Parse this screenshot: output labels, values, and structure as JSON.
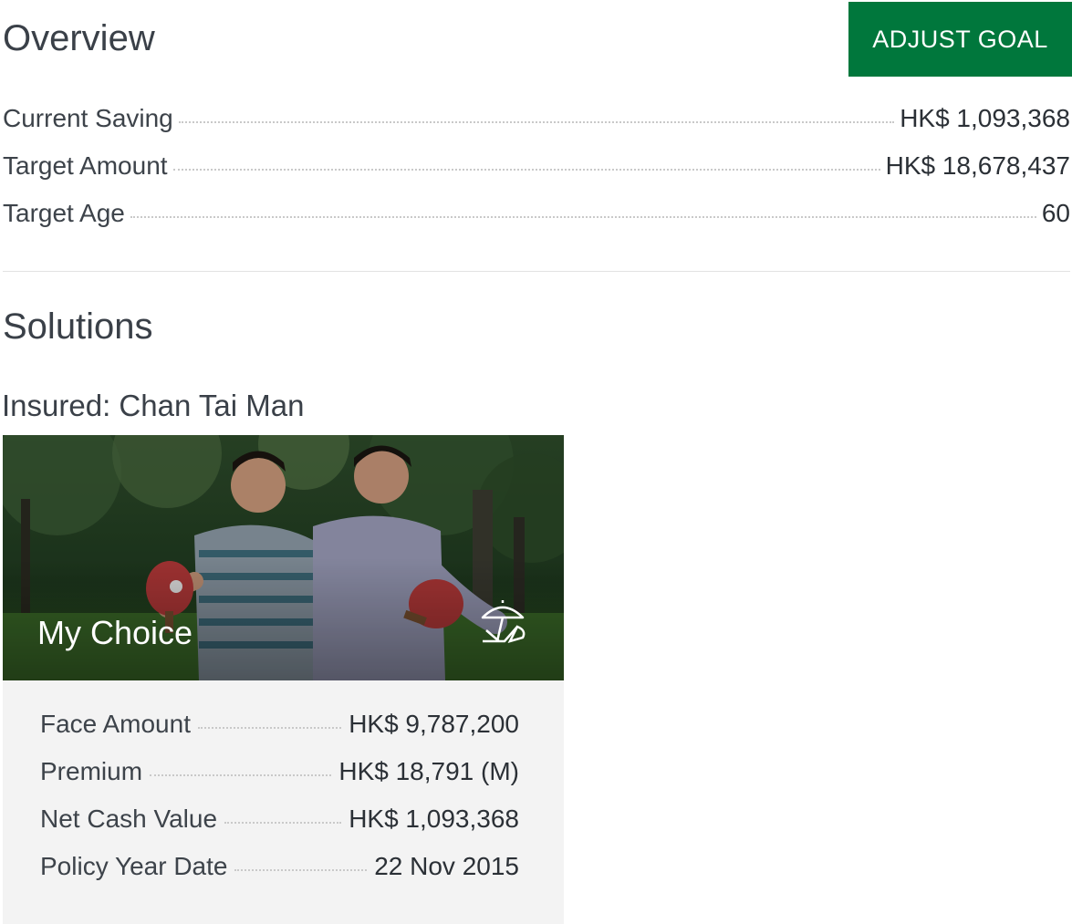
{
  "overview": {
    "title": "Overview",
    "adjust_goal_label": "ADJUST GOAL",
    "rows": [
      {
        "label": "Current Saving",
        "value": "HK$ 1,093,368"
      },
      {
        "label": "Target Amount",
        "value": "HK$ 18,678,437"
      },
      {
        "label": "Target Age",
        "value": "60"
      }
    ]
  },
  "solutions": {
    "title": "Solutions",
    "insured": "Insured: Chan Tai Man",
    "card": {
      "title": "My Choice",
      "icon": "parasol-lounger-icon",
      "rows": [
        {
          "label": "Face Amount",
          "value": "HK$ 9,787,200"
        },
        {
          "label": "Premium",
          "value": "HK$ 18,791 (M)"
        },
        {
          "label": "Net Cash Value",
          "value": "HK$ 1,093,368"
        },
        {
          "label": "Policy Year Date",
          "value": "22 Nov 2015"
        }
      ]
    }
  },
  "colors": {
    "brand": "#00773c",
    "card_bg": "#f3f3f3"
  }
}
